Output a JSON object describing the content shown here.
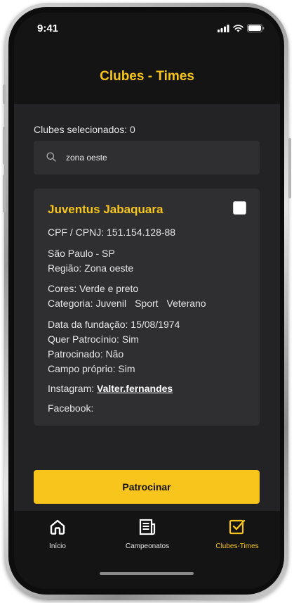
{
  "status_bar": {
    "time": "9:41"
  },
  "header": {
    "title": "Clubes - Times"
  },
  "selection": {
    "label": "Clubes selecionados: 0"
  },
  "search": {
    "value": "zona oeste",
    "icon": "search-icon"
  },
  "club": {
    "name": "Juventus Jabaquara",
    "checked": false,
    "cpf": "CPF / CPNJ: 151.154.128-88",
    "location": "São Paulo - SP",
    "region": "Região: Zona oeste",
    "colors": "Cores: Verde e preto",
    "category_label": "Categoria:",
    "categories": [
      "Juvenil",
      "Sport",
      "Veterano"
    ],
    "founded": "Data da fundação: 15/08/1974",
    "wants_sponsorship": "Quer Patrocínio: Sim",
    "sponsored": "Patrocinado: Não",
    "own_field": "Campo próprio: Sim",
    "instagram_label": "Instagram:",
    "instagram_handle": "Valter.fernandes",
    "facebook_label": "Facebook:"
  },
  "action": {
    "sponsor_label": "Patrocinar"
  },
  "tabs": [
    {
      "label": "Início",
      "icon": "home-icon",
      "active": false
    },
    {
      "label": "Campeonatos",
      "icon": "newspaper-icon",
      "active": false
    },
    {
      "label": "Clubes-Times",
      "icon": "checkbox-icon",
      "active": true
    }
  ],
  "colors": {
    "accent": "#f7c51b",
    "background": "#232325",
    "card": "#2f2f31",
    "bar": "#141414"
  }
}
